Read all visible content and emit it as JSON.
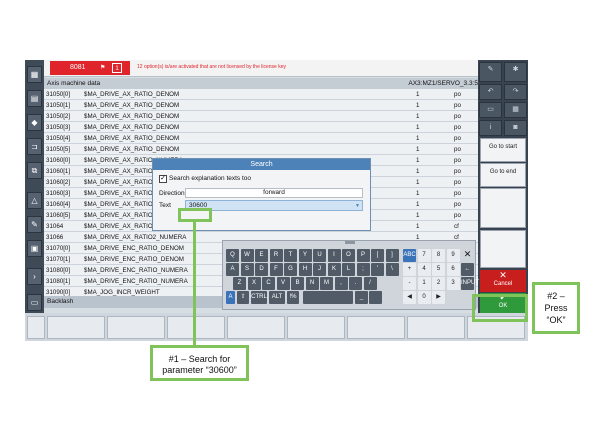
{
  "topbar": {
    "alarm_number": "8081",
    "alarm_count": "1",
    "alarm_message": "12 option(s) is/are activated that are not licensed by the license key"
  },
  "table": {
    "title": "Axis machine data",
    "axis_label": "AX3:MZ1/SERVO_3.3:5",
    "rows": [
      {
        "id": "31050[0]",
        "name": "$MA_DRIVE_AX_RATIO_DENOM",
        "value": "1",
        "unit": "po"
      },
      {
        "id": "31050[1]",
        "name": "$MA_DRIVE_AX_RATIO_DENOM",
        "value": "1",
        "unit": "po"
      },
      {
        "id": "31050[2]",
        "name": "$MA_DRIVE_AX_RATIO_DENOM",
        "value": "1",
        "unit": "po"
      },
      {
        "id": "31050[3]",
        "name": "$MA_DRIVE_AX_RATIO_DENOM",
        "value": "1",
        "unit": "po"
      },
      {
        "id": "31050[4]",
        "name": "$MA_DRIVE_AX_RATIO_DENOM",
        "value": "1",
        "unit": "po"
      },
      {
        "id": "31050[5]",
        "name": "$MA_DRIVE_AX_RATIO_DENOM",
        "value": "1",
        "unit": "po"
      },
      {
        "id": "31060[0]",
        "name": "$MA_DRIVE_AX_RATIO_NUMERA",
        "value": "1",
        "unit": "po"
      },
      {
        "id": "31060[1]",
        "name": "$MA_DRIVE_AX_RATIO",
        "value": "1",
        "unit": "po"
      },
      {
        "id": "31060[2]",
        "name": "$MA_DRIVE_AX_RATIO",
        "value": "1",
        "unit": "po"
      },
      {
        "id": "31060[3]",
        "name": "$MA_DRIVE_AX_RATIO",
        "value": "1",
        "unit": "po"
      },
      {
        "id": "31060[4]",
        "name": "$MA_DRIVE_AX_RATIO",
        "value": "1",
        "unit": "po"
      },
      {
        "id": "31060[5]",
        "name": "$MA_DRIVE_AX_RATIO",
        "value": "1",
        "unit": "po"
      },
      {
        "id": "31064",
        "name": "$MA_DRIVE_AX_RATIO2",
        "value": "1",
        "unit": "cf"
      },
      {
        "id": "31066",
        "name": "$MA_DRIVE_AX_RATIO2_NUMERA",
        "value": "1",
        "unit": "cf"
      },
      {
        "id": "31070[0]",
        "name": "$MA_DRIVE_ENC_RATIO_DENOM",
        "value": "1",
        "unit": ""
      },
      {
        "id": "31070[1]",
        "name": "$MA_DRIVE_ENC_RATIO_DENOM",
        "value": "1",
        "unit": ""
      },
      {
        "id": "31080[0]",
        "name": "$MA_DRIVE_ENC_RATIO_NUMERA",
        "value": "1",
        "unit": ""
      },
      {
        "id": "31080[1]",
        "name": "$MA_DRIVE_ENC_RATIO_NUMERA",
        "value": "1",
        "unit": ""
      },
      {
        "id": "31090[0]",
        "name": "$MA_JOG_INCR_WEIGHT",
        "value": "",
        "unit": ""
      }
    ],
    "footer_label": "Backlash"
  },
  "dialog": {
    "title": "Search",
    "checkbox_label": "Search explanation texts too",
    "direction_label": "Direction",
    "direction_value": "forward",
    "text_label": "Text",
    "text_value": "30600"
  },
  "keyboard": {
    "row1": [
      "Q",
      "W",
      "E",
      "R",
      "T",
      "Y",
      "U",
      "I",
      "O",
      "P",
      "[",
      "]"
    ],
    "row1_right": [
      "ABC",
      "7",
      "8",
      "9"
    ],
    "row2": [
      "A",
      "S",
      "D",
      "F",
      "G",
      "H",
      "J",
      "K",
      "L",
      ";",
      "'",
      "\\"
    ],
    "row2_right": [
      "+",
      "4",
      "5",
      "6"
    ],
    "row3": [
      "Z",
      "X",
      "C",
      "V",
      "B",
      "N",
      "M",
      ",",
      ".",
      "/"
    ],
    "row3_right": [
      "-",
      "1",
      "2",
      "3"
    ],
    "row4": [
      "A",
      "⇧",
      "CTRL",
      "ALT",
      "!%"
    ],
    "row4_right": [
      "◀",
      "0",
      "▶"
    ],
    "input_label": "INPUT"
  },
  "rightbar": {
    "go_to_start": "Go to start",
    "go_to_end": "Go to end",
    "cancel": "Cancel",
    "ok": "OK"
  },
  "annotations": {
    "step1": "#1 – Search for parameter “30600”",
    "step2": "#2 – Press “OK”"
  },
  "colors": {
    "alarm": "#e0242b",
    "dialog_title": "#4d82b8",
    "cancel": "#c81e1e",
    "ok": "#2f9a3c",
    "annotation": "#7fc35a"
  }
}
